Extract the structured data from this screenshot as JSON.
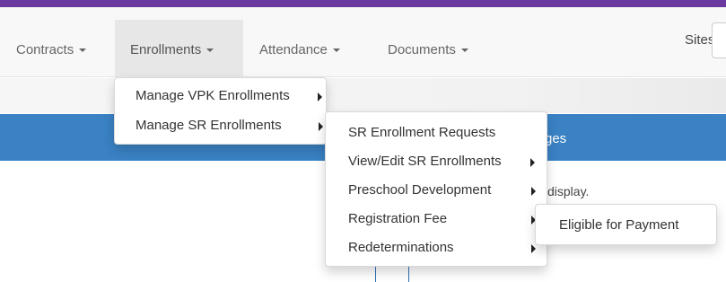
{
  "navbar": {
    "items": [
      {
        "label": "Contracts"
      },
      {
        "label": "Enrollments"
      },
      {
        "label": "Attendance"
      },
      {
        "label": "Documents"
      }
    ],
    "sites_label": "Sites:",
    "active_index": 1
  },
  "colors": {
    "top_bar": "#6a3aa0",
    "blue_band": "#3a82c4",
    "navbar_bg": "#f8f8f8"
  },
  "enrollments_menu": {
    "items": [
      {
        "label": "Manage VPK Enrollments"
      },
      {
        "label": "Manage SR Enrollments"
      }
    ]
  },
  "sr_enrollments_menu": {
    "items": [
      {
        "label": "SR Enrollment Requests"
      },
      {
        "label": "View/Edit SR Enrollments"
      },
      {
        "label": "Preschool Development"
      },
      {
        "label": "Registration Fee"
      },
      {
        "label": "Redeterminations"
      }
    ]
  },
  "registration_fee_menu": {
    "items": [
      {
        "label": "Eligible for Payment"
      }
    ]
  },
  "background": {
    "blue_band_text": "ges",
    "content_text": "display."
  },
  "icons": {
    "dropdown_caret": "caret-down-icon",
    "submenu_arrow": "caret-right-icon"
  }
}
